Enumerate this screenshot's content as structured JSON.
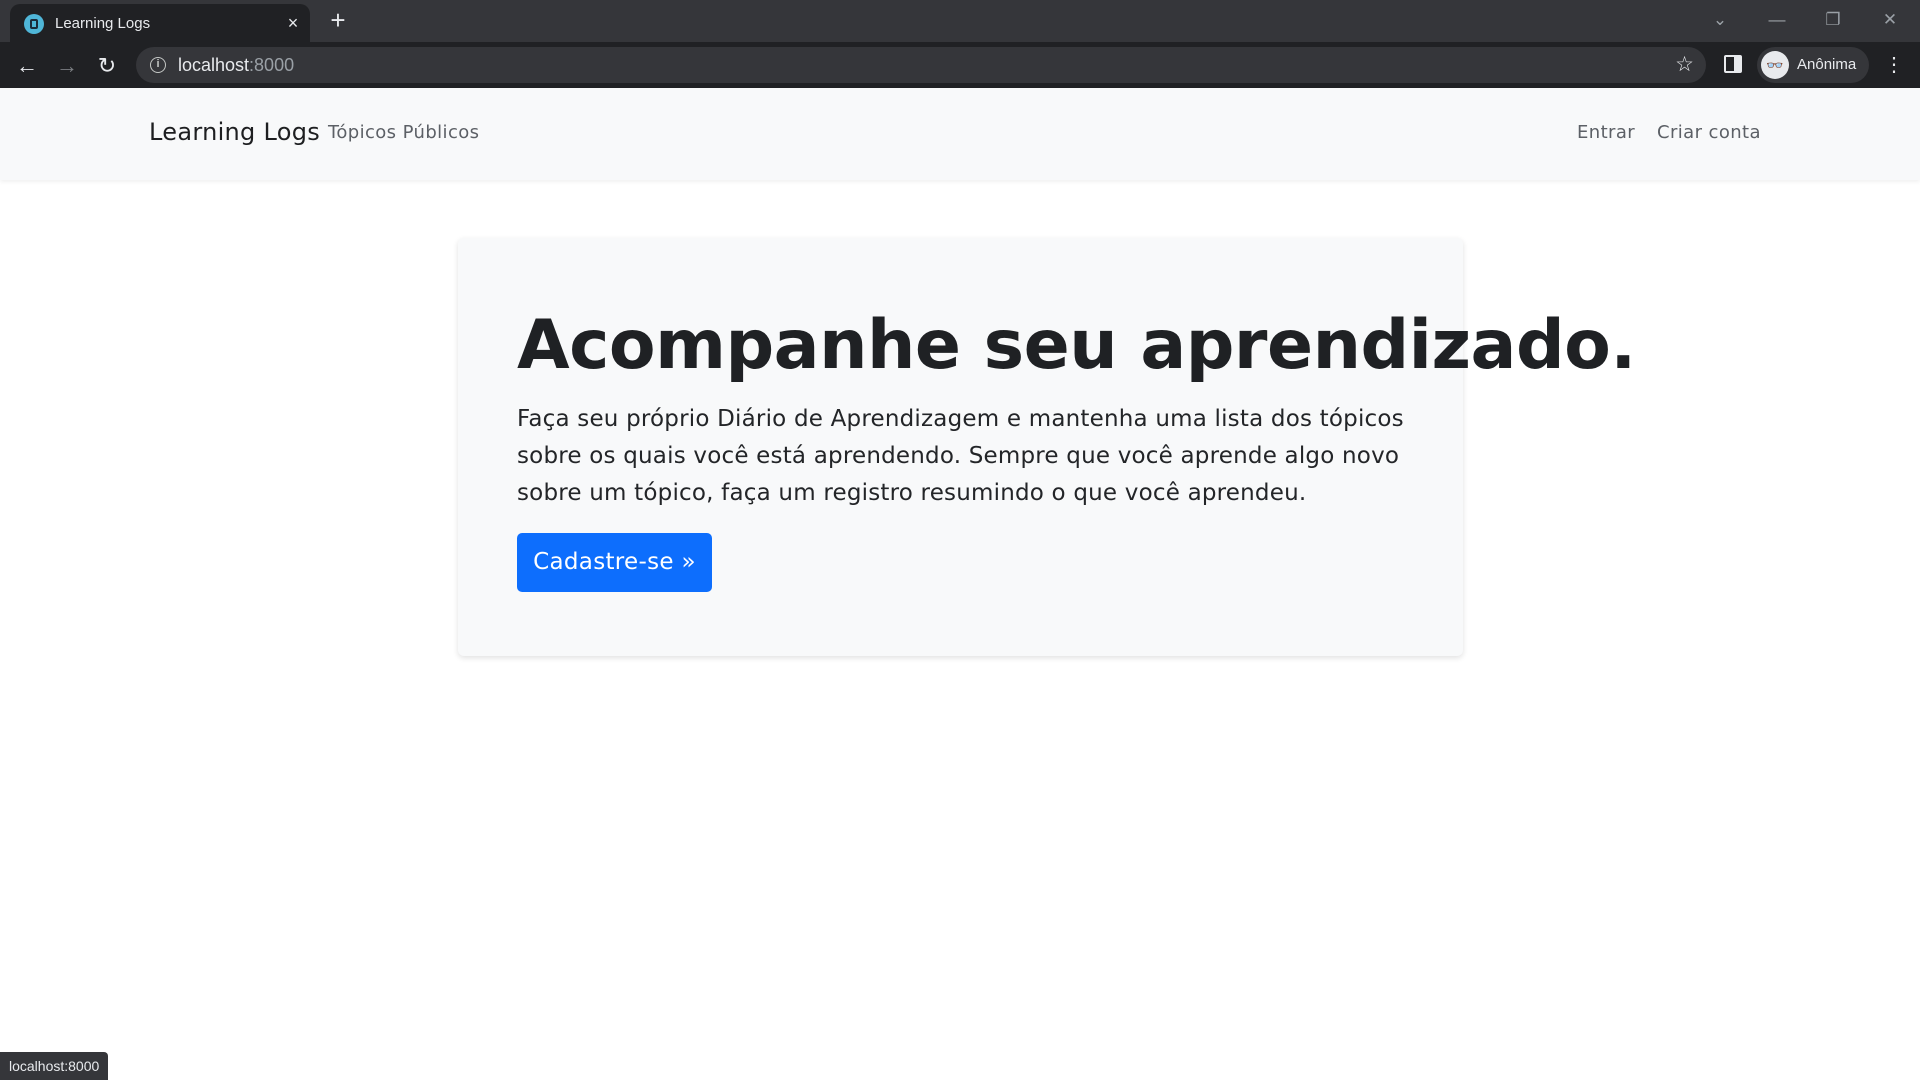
{
  "browser": {
    "tab": {
      "title": "Learning Logs",
      "close_icon": "×",
      "favicon": "learning-logs-favicon"
    },
    "new_tab_icon": "+",
    "window_controls": {
      "tab_search_icon": "⌄",
      "minimize_icon": "—",
      "restore_icon": "❐",
      "close_icon": "✕"
    },
    "nav": {
      "back_icon": "←",
      "forward_icon": "→",
      "reload_icon": "↻"
    },
    "address": {
      "host": "localhost",
      "port": ":8000",
      "info_icon": "i"
    },
    "bookmark_icon": "☆",
    "profile": {
      "name": "Anônima",
      "avatar_icon": "incognito-icon"
    },
    "menu_icon": "⋮"
  },
  "navbar": {
    "brand": "Learning Logs",
    "public_topics": "Tópicos Públicos",
    "login": "Entrar",
    "register": "Criar conta"
  },
  "hero": {
    "title": "Acompanhe seu aprendizado.",
    "text": "Faça seu próprio Diário de Aprendizagem e mantenha uma lista dos tópicos sobre os quais você está aprendendo. Sempre que você aprende algo novo sobre um tópico, faça um registro resumindo o que você aprendeu.",
    "button": "Cadastre-se »"
  },
  "status_bar": {
    "url": "localhost:8000"
  },
  "colors": {
    "primary_button": "#0d6efd",
    "navbar_bg": "#f8f9fa",
    "chrome_dark": "#202124",
    "tabstrip": "#35363a"
  }
}
